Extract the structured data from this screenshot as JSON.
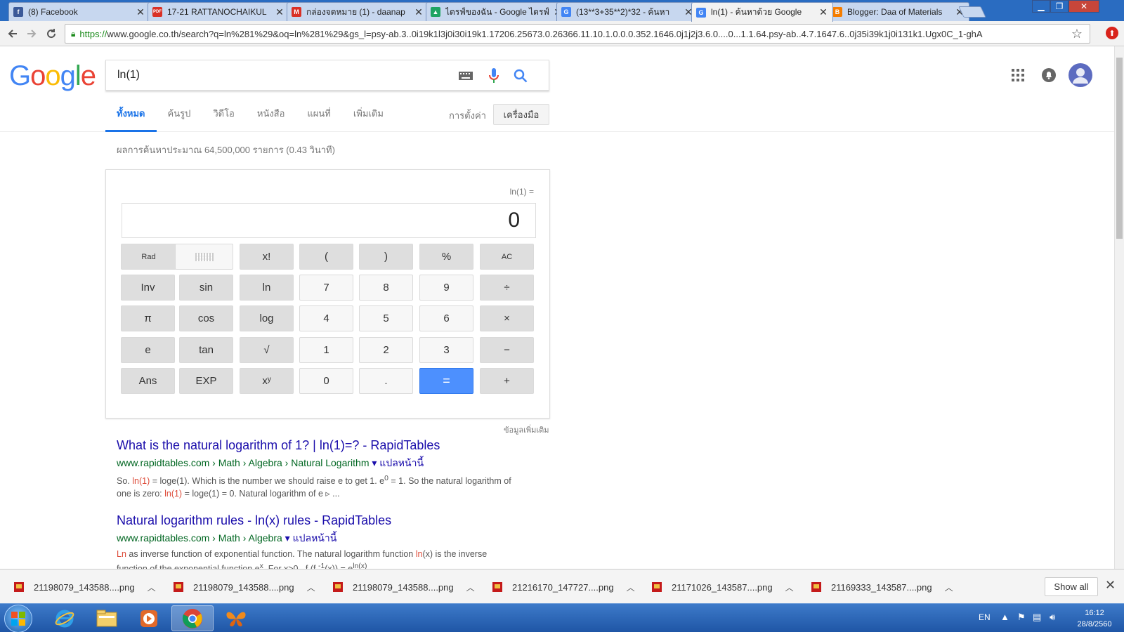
{
  "browser": {
    "tabs": [
      {
        "label": "(8) Facebook",
        "icon": "facebook-icon",
        "color": "#3b5998",
        "glyph": "f"
      },
      {
        "label": "17-21 RATTANOCHAIKUL",
        "icon": "pdf-icon",
        "color": "#d93025",
        "glyph": "PDF"
      },
      {
        "label": "กล่องจดหมาย (1) - daanap",
        "icon": "gmail-icon",
        "color": "#d93025",
        "glyph": "M"
      },
      {
        "label": "ไดรฟ์ของฉัน - Google ไดรฟ์",
        "icon": "drive-icon",
        "color": "#1fa463",
        "glyph": "▲"
      },
      {
        "label": "(13**3+35**2)*32 - ค้นหา",
        "icon": "google-icon",
        "color": "#4285f4",
        "glyph": "G"
      },
      {
        "label": "ln(1) - ค้นหาด้วย Google",
        "icon": "google-icon",
        "color": "#4285f4",
        "glyph": "G",
        "active": true
      },
      {
        "label": "Blogger: Daa of Materials",
        "icon": "blogger-icon",
        "color": "#f57d00",
        "glyph": "B"
      }
    ],
    "url_secure": "https://",
    "url_rest": "www.google.co.th/search?q=ln%281%29&oq=ln%281%29&gs_l=psy-ab.3..0i19k1l3j0i30i19k1.17206.25673.0.26366.11.10.1.0.0.0.352.1646.0j1j2j3.6.0....0...1.1.64.psy-ab..4.7.1647.6..0j35i39k1j0i131k1.Ugx0C_1-ghA"
  },
  "google": {
    "logo": "Google",
    "query": "ln(1)",
    "tabs": [
      "ทั้งหมด",
      "ค้นรูป",
      "วิดีโอ",
      "หนังสือ",
      "แผนที่",
      "เพิ่มเติม"
    ],
    "settings": "การตั้งค่า",
    "tools": "เครื่องมือ",
    "stats": "ผลการค้นหาประมาณ 64,500,000 รายการ (0.43 วินาที)"
  },
  "calculator": {
    "expression": "ln(1) =",
    "display": "0",
    "keys": [
      [
        "Rad",
        "",
        "x!",
        "(",
        ")",
        "%",
        "AC"
      ],
      [
        "Inv",
        "sin",
        "ln",
        "7",
        "8",
        "9",
        "÷"
      ],
      [
        "π",
        "cos",
        "log",
        "4",
        "5",
        "6",
        "×"
      ],
      [
        "e",
        "tan",
        "√",
        "1",
        "2",
        "3",
        "−"
      ],
      [
        "Ans",
        "EXP",
        "xʸ",
        "0",
        ".",
        "=",
        "+"
      ]
    ],
    "more_info": "ข้อมูลเพิ่มเติม"
  },
  "results": [
    {
      "title": "What is the natural logarithm of 1? | ln(1)=? - RapidTables",
      "url": "www.rapidtables.com › Math › Algebra › Natural Logarithm",
      "translate": "แปลหน้านี้",
      "snippet_1_pre": "So. ",
      "snippet_1_hl": "ln(1)",
      "snippet_1_post": " = loge(1). Which is the number we should raise e to get 1. e",
      "snippet_1_sup": "0",
      "snippet_1_end": " = 1. So the natural logarithm of",
      "snippet_2_pre": "one is zero: ",
      "snippet_2_hl": "ln(1)",
      "snippet_2_post": " = loge(1) = 0. Natural logarithm of e ▹ ..."
    },
    {
      "title": "Natural logarithm rules - ln(x) rules - RapidTables",
      "url": "www.rapidtables.com › Math › Algebra",
      "translate": "แปลหน้านี้",
      "snippet_1_hl": "Ln",
      "snippet_1_mid": " as inverse function of exponential function. The natural logarithm function ",
      "snippet_1_hl2": "ln",
      "snippet_1_post": "(x) is the inverse",
      "snippet_2_pre": "function of the exponential function e",
      "snippet_2_sup": "x",
      "snippet_2_mid": ". For x>0,. f (f ",
      "snippet_2_sup2": "-1",
      "snippet_2_mid2": "(x)) = e",
      "snippet_2_sup3": "ln(x)",
      "snippet_2_end": " ..."
    }
  ],
  "downloads": {
    "items": [
      "21198079_143588....png",
      "21198079_143588....png",
      "21198079_143588....png",
      "21216170_147727....png",
      "21171026_143587....png",
      "21169333_143587....png"
    ],
    "show_all": "Show all"
  },
  "taskbar": {
    "apps": [
      "internet-explorer-icon",
      "file-explorer-icon",
      "media-player-icon",
      "chrome-icon",
      "butterfly-app-icon"
    ],
    "lang": "EN",
    "time": "16:12",
    "date": "28/8/2560"
  }
}
